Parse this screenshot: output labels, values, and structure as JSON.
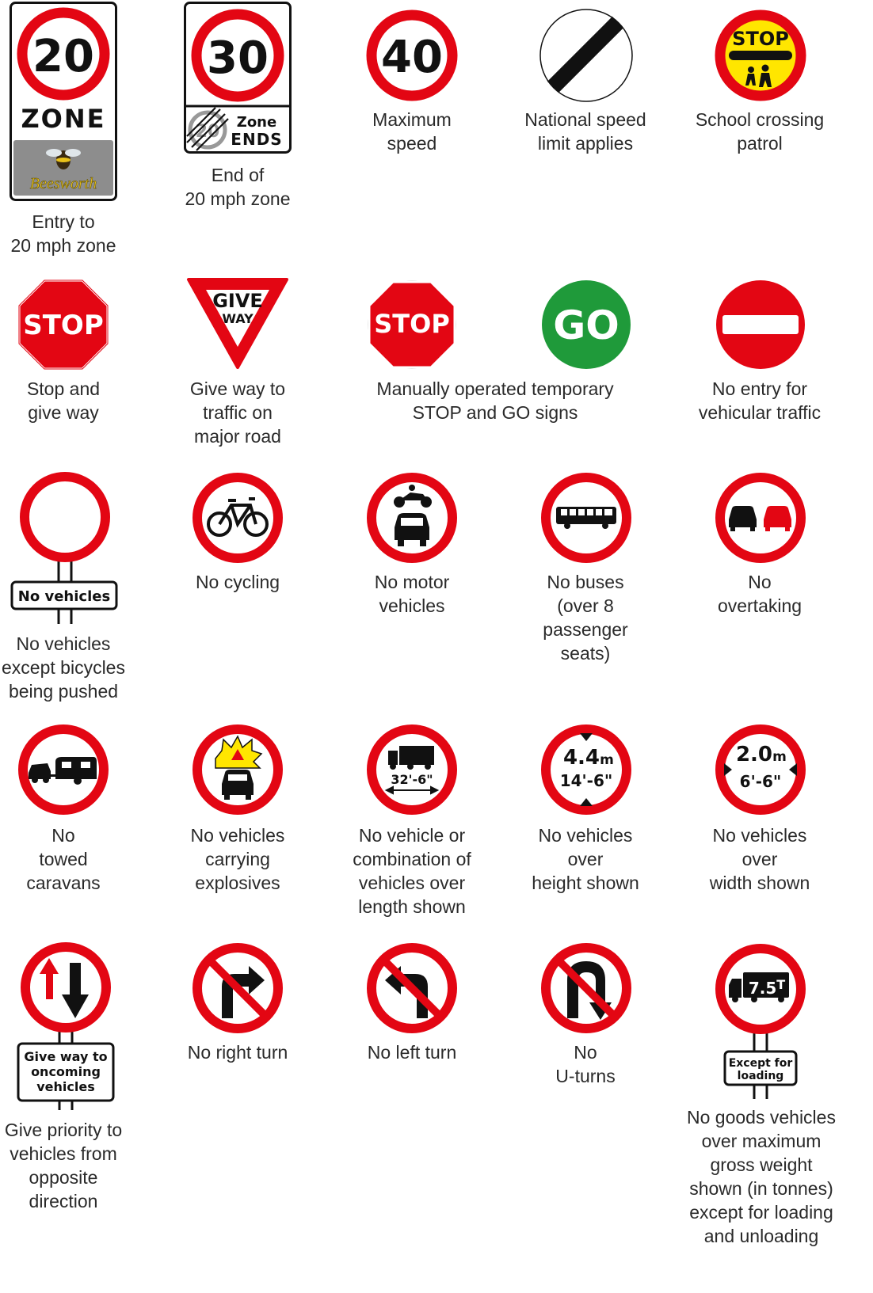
{
  "colors": {
    "red": "#e30613",
    "black": "#111111",
    "green": "#1f9a3a",
    "yellow": "#ffe600",
    "grey": "#8a8a8a"
  },
  "signs": [
    {
      "id": "zone20",
      "number": "20",
      "word": "ZONE",
      "town": "Beesworth",
      "caption": "Entry to\n20 mph zone"
    },
    {
      "id": "zone-end",
      "number": "30",
      "small_number": "20",
      "top": "Zone",
      "bottom": "ENDS",
      "caption": "End of\n20 mph zone"
    },
    {
      "id": "max40",
      "number": "40",
      "caption": "Maximum\nspeed"
    },
    {
      "id": "national",
      "caption": "National speed\nlimit applies"
    },
    {
      "id": "school",
      "word": "STOP",
      "caption": "School crossing\npatrol"
    },
    {
      "id": "stop",
      "word": "STOP",
      "caption": "Stop and\ngive way"
    },
    {
      "id": "giveway",
      "word1": "GIVE",
      "word2": "WAY",
      "caption": "Give way to\ntraffic on\nmajor road"
    },
    {
      "id": "stopgo",
      "word1": "STOP",
      "word2": "GO",
      "caption": "Manually operated temporary\nSTOP and GO signs"
    },
    {
      "id": "noentry",
      "caption": "No entry for\nvehicular traffic"
    },
    {
      "id": "novehicles",
      "plate": "No vehicles",
      "caption": "No vehicles\nexcept bicycles\nbeing pushed"
    },
    {
      "id": "nocycling",
      "caption": "No cycling"
    },
    {
      "id": "nomotor",
      "caption": "No motor\nvehicles"
    },
    {
      "id": "nobuses",
      "caption": "No buses\n(over 8\npassenger\nseats)"
    },
    {
      "id": "noovertaking",
      "caption": "No\novertaking"
    },
    {
      "id": "nocaravans",
      "caption": "No\ntowed\ncaravans"
    },
    {
      "id": "noexplosives",
      "caption": "No vehicles\ncarrying\nexplosives"
    },
    {
      "id": "nolength",
      "value": "32'-6\"",
      "caption": "No vehicle or\ncombination of\nvehicles over\nlength shown"
    },
    {
      "id": "noheight",
      "metric": "4.4",
      "unit": "m",
      "imperial": "14'-6\"",
      "caption": "No vehicles\nover\nheight shown"
    },
    {
      "id": "nowidth",
      "metric": "2.0",
      "unit": "m",
      "imperial": "6'-6\"",
      "caption": "No vehicles\nover\nwidth shown"
    },
    {
      "id": "priority",
      "plate": "Give way to\noncoming\nvehicles",
      "caption": "Give priority to\nvehicles from\nopposite\ndirection"
    },
    {
      "id": "noright",
      "caption": "No right turn"
    },
    {
      "id": "noleft",
      "caption": "No left turn"
    },
    {
      "id": "nouturn",
      "caption": "No\nU-turns"
    },
    {
      "id": "nogoods",
      "weight": "7.5",
      "unit": "T",
      "plate": "Except for\nloading",
      "caption": "No goods vehicles\nover maximum\ngross weight\nshown (in tonnes)\nexcept for loading\nand unloading"
    }
  ]
}
